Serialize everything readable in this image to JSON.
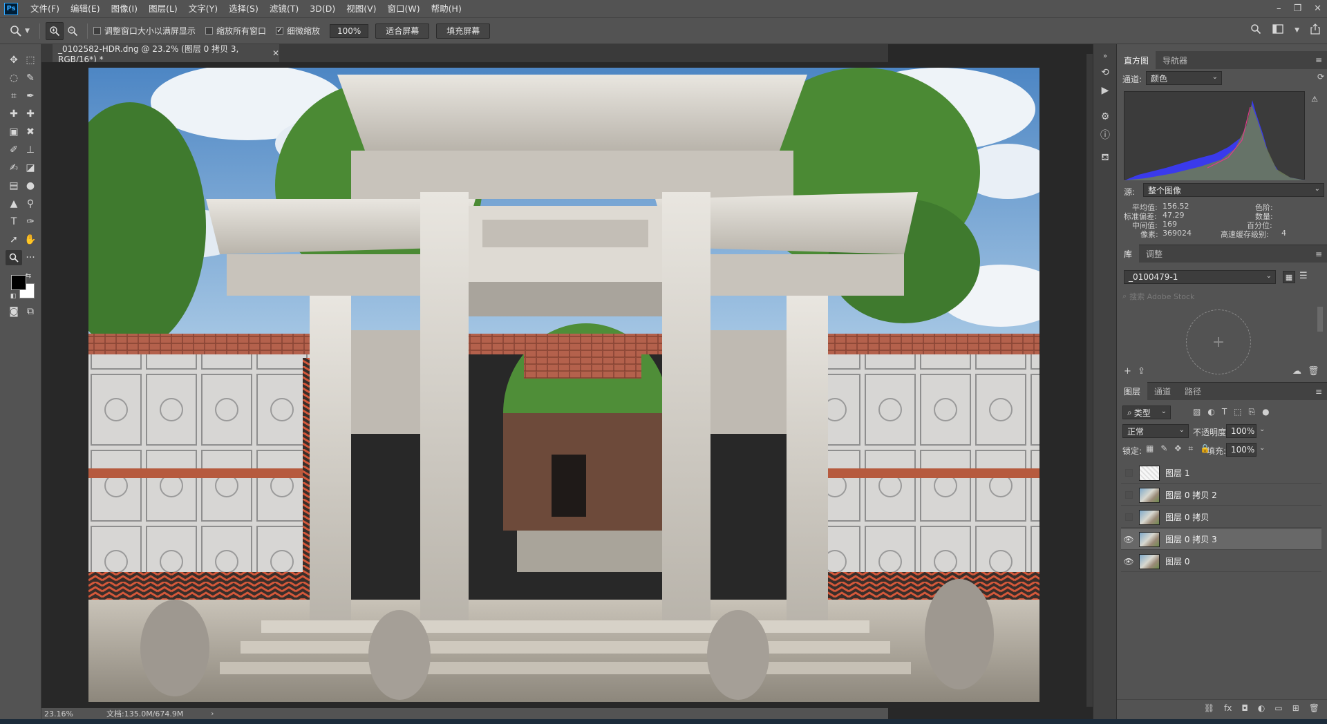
{
  "app": {
    "logo": "Ps",
    "menu": [
      "文件(F)",
      "编辑(E)",
      "图像(I)",
      "图层(L)",
      "文字(Y)",
      "选择(S)",
      "滤镜(T)",
      "3D(D)",
      "视图(V)",
      "窗口(W)",
      "帮助(H)"
    ]
  },
  "options": {
    "resize_windows": "调整窗口大小以满屏显示",
    "zoom_all": "缩放所有窗口",
    "scrubby_zoom": "细微缩放",
    "zoom_value": "100%",
    "fit_screen": "适合屏幕",
    "fill_screen": "填充屏幕"
  },
  "document": {
    "tab_title": "_0102582-HDR.dng @ 23.2% (图层 0 拷贝 3, RGB/16*) *",
    "zoom": "23.16%",
    "doc_info": "文档:135.0M/674.9M"
  },
  "histogram": {
    "tabs": [
      "直方图",
      "导航器"
    ],
    "channel_label": "通道:",
    "channel_value": "颜色",
    "source_label": "源:",
    "source_value": "整个图像",
    "stats_left": [
      {
        "label": "平均值:",
        "value": "156.52"
      },
      {
        "label": "标准偏差:",
        "value": "47.29"
      },
      {
        "label": "中间值:",
        "value": "169"
      },
      {
        "label": "像素:",
        "value": "369024"
      }
    ],
    "stats_right": [
      {
        "label": "色阶:",
        "value": ""
      },
      {
        "label": "数量:",
        "value": ""
      },
      {
        "label": "百分位:",
        "value": ""
      },
      {
        "label": "高速缓存级别:",
        "value": "4"
      }
    ]
  },
  "library": {
    "tabs": [
      "库",
      "调整"
    ],
    "library_name": "_0100479-1",
    "search_placeholder": "搜索 Adobe Stock"
  },
  "layers": {
    "tabs": [
      "图层",
      "通道",
      "路径"
    ],
    "filter_kind": "类型",
    "blend_mode": "正常",
    "opacity_label": "不透明度:",
    "opacity_value": "100%",
    "lock_label": "锁定:",
    "fill_label": "填充:",
    "fill_value": "100%",
    "items": [
      {
        "name": "图层 1",
        "visible": false,
        "selected": false
      },
      {
        "name": "图层 0 拷贝 2",
        "visible": false,
        "selected": false
      },
      {
        "name": "图层 0 拷贝",
        "visible": false,
        "selected": false
      },
      {
        "name": "图层 0 拷贝 3",
        "visible": true,
        "selected": true
      },
      {
        "name": "图层 0",
        "visible": true,
        "selected": false
      }
    ]
  },
  "colors": {
    "accent": "#31a8ff",
    "panel_bg": "#535353",
    "canvas_bg": "#282828"
  }
}
